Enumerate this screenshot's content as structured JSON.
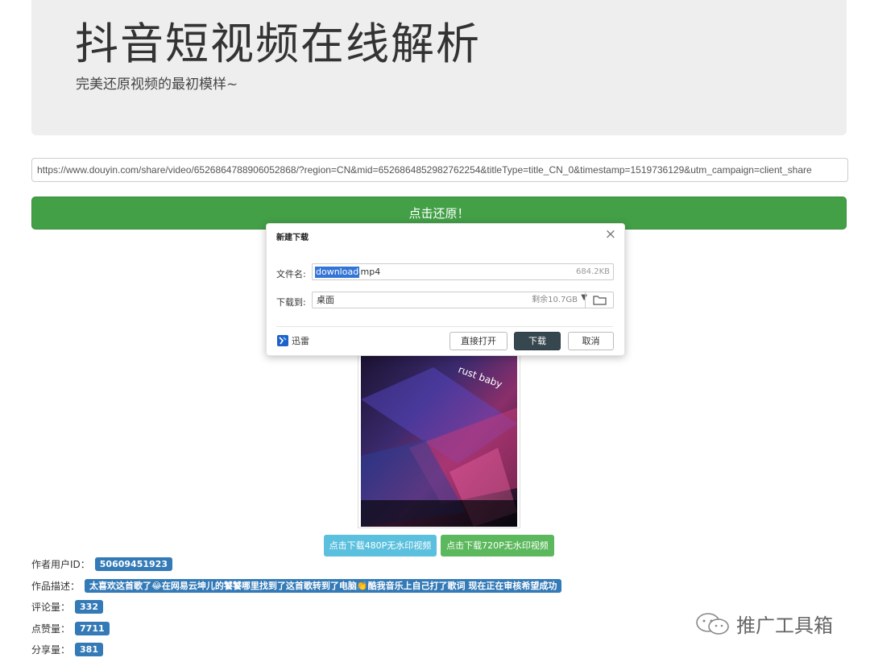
{
  "header": {
    "title": "抖音短视频在线解析",
    "subtitle": "完美还原视频的最初模样~"
  },
  "form": {
    "url_value": "https://www.douyin.com/share/video/6526864788906052868/?region=CN&mid=6526864852982762254&titleType=title_CN_0&timestamp=1519736129&utm_campaign=client_share",
    "submit_label": "点击还原！"
  },
  "video": {
    "overlay_text": "rust baby"
  },
  "downloads": {
    "btn_480_label": "点击下载480P无水印视频",
    "btn_720_label": "点击下载720P无水印视频"
  },
  "info": {
    "author_id_label": "作者用户ID：",
    "author_id_value": "50609451923",
    "desc_label": "作品描述：",
    "desc_value": "太喜欢这首歌了😂在网易云坤儿的饕饕哪里找到了这首歌转到了电脑👏酷我音乐上自己打了歌词 现在正在审核希望成功",
    "comments_label": "评论量：",
    "comments_value": "332",
    "likes_label": "点赞量：",
    "likes_value": "7711",
    "shares_label": "分享量：",
    "shares_value": "381"
  },
  "dialog": {
    "title": "新建下载",
    "filename_label": "文件名:",
    "filename_selected": "download",
    "filename_ext": ".mp4",
    "file_size": "684.2KB",
    "saveto_label": "下载到:",
    "saveto_value": "桌面",
    "free_space": "剩余10.7GB",
    "brand_name": "迅雷",
    "open_label": "直接打开",
    "download_label": "下载",
    "cancel_label": "取消"
  },
  "watermark": {
    "text": "推广工具箱"
  },
  "colors": {
    "submit_green": "#43a047",
    "badge_blue": "#337ab7",
    "btn_info": "#5bc0de",
    "btn_success": "#5cb85c",
    "dialog_primary": "#37474f"
  }
}
